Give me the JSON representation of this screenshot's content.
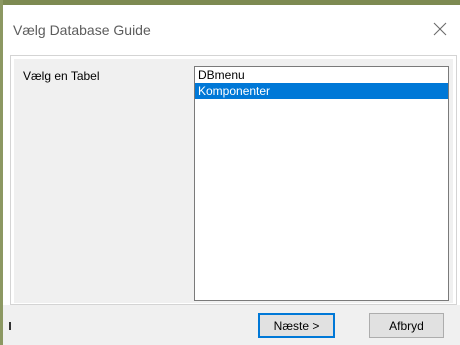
{
  "dialog": {
    "title": "Vælg Database Guide",
    "close_icon": "close-icon"
  },
  "form": {
    "table_label": "Vælg en Tabel",
    "tables": [
      "DBmenu",
      "Komponenter"
    ],
    "selected_table": "Komponenter"
  },
  "buttons": {
    "next_label": "Næste >",
    "cancel_label": "Afbryd"
  },
  "colors": {
    "selection": "#0078d7",
    "panel": "#f0f0f0",
    "window_edge": "#7d8a52"
  }
}
